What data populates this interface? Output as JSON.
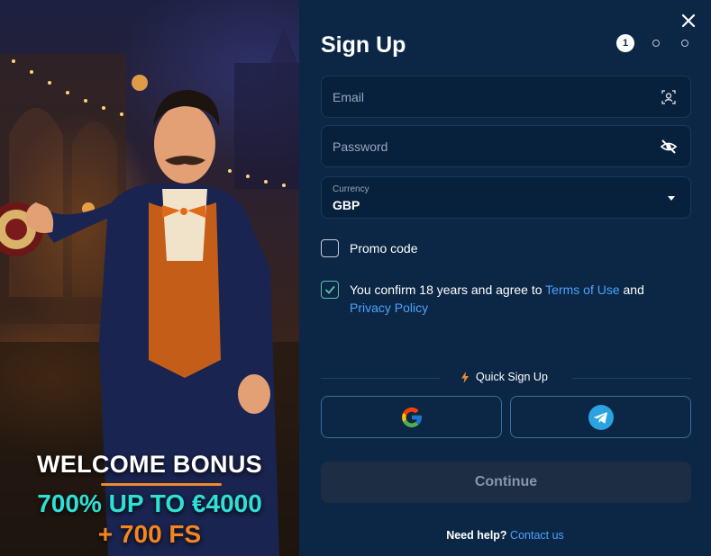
{
  "promo": {
    "title": "WELCOME BONUS",
    "amount": "700% UP TO €4000",
    "free_spins": "+ 700 FS",
    "colors": {
      "amount": "#2fe0d6",
      "free_spins": "#f5861f",
      "divider": "#f08a2a"
    }
  },
  "form": {
    "title": "Sign Up",
    "steps": {
      "current": "1",
      "total": 3
    },
    "email": {
      "placeholder": "Email",
      "icon": "contact-id-icon"
    },
    "password": {
      "placeholder": "Password",
      "icon": "eye-off-icon"
    },
    "currency": {
      "label": "Currency",
      "value": "GBP"
    },
    "promo_code": {
      "label": "Promo code",
      "checked": false
    },
    "consent": {
      "checked": true,
      "text_before": "You confirm 18 years and agree to",
      "terms_link": "Terms of Use",
      "and": "and",
      "privacy_link": "Privacy Policy"
    },
    "quick_signup": {
      "label": "Quick Sign Up",
      "providers": [
        {
          "name": "Google",
          "icon": "google-icon"
        },
        {
          "name": "Telegram",
          "icon": "telegram-icon"
        }
      ]
    },
    "continue_label": "Continue",
    "help": {
      "question": "Need help?",
      "link": "Contact us"
    }
  },
  "colors": {
    "panel_bg": "#0b2745",
    "field_bg": "#07203b",
    "link": "#4ea2ff",
    "button_disabled_bg": "#1c2d44"
  }
}
